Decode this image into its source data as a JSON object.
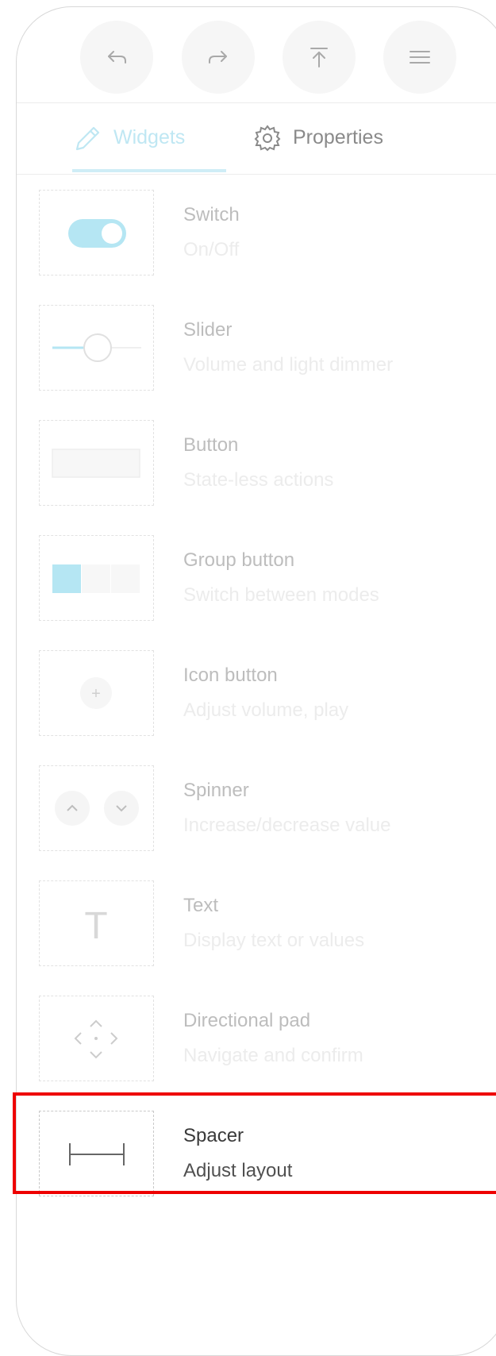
{
  "toolbar": {
    "buttons": [
      {
        "icon": "undo-icon"
      },
      {
        "icon": "redo-icon"
      },
      {
        "icon": "upload-icon"
      },
      {
        "icon": "menu-icon"
      }
    ]
  },
  "tabs": [
    {
      "label": "Widgets",
      "icon": "pencil-icon",
      "active": true
    },
    {
      "label": "Properties",
      "icon": "gear-icon",
      "active": false
    }
  ],
  "widgets": [
    {
      "title": "Switch",
      "subtitle": "On/Off",
      "icon": "switch-preview"
    },
    {
      "title": "Slider",
      "subtitle": "Volume and light dimmer",
      "icon": "slider-preview"
    },
    {
      "title": "Button",
      "subtitle": "State-less actions",
      "icon": "button-preview"
    },
    {
      "title": "Group button",
      "subtitle": "Switch between modes",
      "icon": "group-button-preview"
    },
    {
      "title": "Icon button",
      "subtitle": "Adjust volume, play",
      "icon": "icon-button-preview",
      "glyph": "+"
    },
    {
      "title": "Spinner",
      "subtitle": "Increase/decrease value",
      "icon": "spinner-preview"
    },
    {
      "title": "Text",
      "subtitle": "Display text or values",
      "icon": "text-preview",
      "glyph": "T"
    },
    {
      "title": "Directional pad",
      "subtitle": "Navigate and confirm",
      "icon": "dpad-preview"
    },
    {
      "title": "Spacer",
      "subtitle": "Adjust layout",
      "icon": "spacer-preview",
      "highlighted": true
    }
  ],
  "colors": {
    "accent": "#b5e6f3",
    "highlight_border": "#ee0000",
    "muted_text": "#bdbdbd"
  }
}
